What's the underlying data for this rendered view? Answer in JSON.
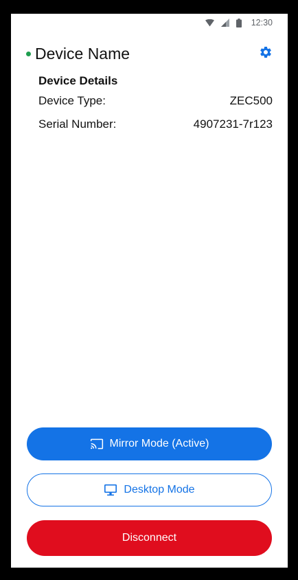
{
  "status_bar": {
    "time": "12:30",
    "icons": [
      "wifi-icon",
      "cellular-signal-icon",
      "battery-icon"
    ]
  },
  "header": {
    "device_name": "Device Name",
    "status": "online",
    "settings_icon": "gear-icon"
  },
  "details": {
    "title": "Device Details",
    "rows": [
      {
        "label": "Device Type:",
        "value": "ZEC500"
      },
      {
        "label": "Serial Number:",
        "value": "4907231-7r123"
      }
    ]
  },
  "actions": {
    "mirror_label": "Mirror Mode (Active)",
    "mirror_icon": "cast-icon",
    "desktop_label": "Desktop Mode",
    "desktop_icon": "monitor-icon",
    "disconnect_label": "Disconnect"
  },
  "colors": {
    "accent": "#1473e6",
    "danger": "#e00d1e",
    "online": "#1e9e4f"
  }
}
